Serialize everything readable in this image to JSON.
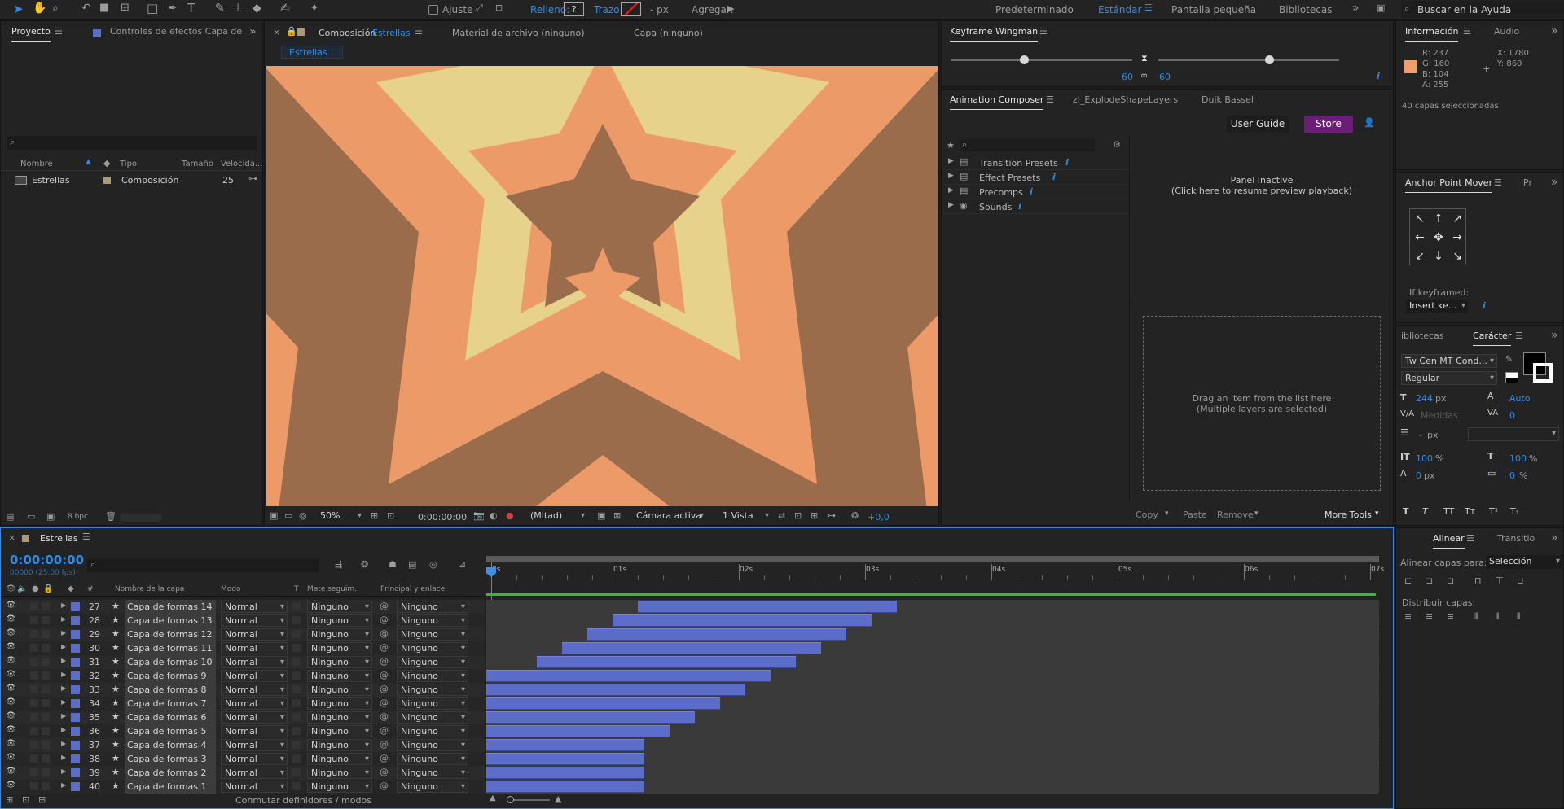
{
  "toolbar": {
    "snap_label": "Ajuste",
    "fill_label": "Relleno:",
    "fill_value": "?",
    "stroke_label": "Trazo:",
    "stroke_unit": "-  px",
    "add_label": "Agregar:",
    "workspaces": [
      "Predeterminado",
      "Estándar",
      "Pantalla pequeña",
      "Bibliotecas"
    ],
    "active_workspace": "Estándar",
    "search_placeholder": "Buscar en la Ayuda"
  },
  "project": {
    "tab": "Proyecto",
    "effects_tab": "Controles de efectos Capa de",
    "cols": [
      "Nombre",
      "Tipo",
      "Tamaño",
      "Velocida..."
    ],
    "item_name": "Estrellas",
    "item_type": "Composición",
    "item_speed": "25",
    "bpc": "8 bpc"
  },
  "comp": {
    "tab_prefix": "Composición",
    "tab_name": "Estrellas",
    "footage_tab": "Material de archivo  (ninguno)",
    "layer_tab": "Capa  (ninguno)",
    "breadcrumb": "Estrellas",
    "zoom": "50%",
    "timecode": "0:00:00:00",
    "resolution": "(Mitad)",
    "camera": "Cámara activa",
    "views": "1 Vista",
    "exposure": "+0,0"
  },
  "colors": {
    "bg_salmon": "#ec9b68",
    "brown": "#9b6c4c",
    "cream": "#e6d28a",
    "accent": "#2d8ceb",
    "layer_bar": "#5c6cc9"
  },
  "wingman": {
    "title": "Keyframe Wingman",
    "left_val": "60",
    "right_val": "60"
  },
  "composer": {
    "tabs": [
      "Animation Composer",
      "zl_ExplodeShapeLayers",
      "Duik Bassel"
    ],
    "guide_btn": "User Guide",
    "store_btn": "Store",
    "tree": [
      "Transition Presets",
      "Effect Presets",
      "Precomps",
      "Sounds"
    ],
    "inactive_1": "Panel Inactive",
    "inactive_2": "(Click here to resume preview playback)",
    "drop_1": "Drag an item from the list here",
    "drop_2": "(Multiple layers are selected)",
    "copy": "Copy",
    "paste": "Paste",
    "remove": "Remove",
    "more": "More Tools"
  },
  "info": {
    "tab": "Información",
    "audio_tab": "Audio",
    "r": "R:  237",
    "g": "G:  160",
    "b": "B:  104",
    "a": "A:  255",
    "x": "X:  1780",
    "y": "Y:  860",
    "selected": "40 capas seleccionadas"
  },
  "apm": {
    "title": "Anchor Point Mover",
    "extra": "Pr",
    "if_label": "If keyframed:",
    "if_value": "Insert ke..."
  },
  "char": {
    "libs": "ibliotecas",
    "tab": "Carácter",
    "font": "Tw Cen MT Cond...",
    "style": "Regular",
    "size": "244",
    "size_unit": "px",
    "leading": "Auto",
    "kern": "Medidas",
    "track": "0",
    "stroke_w": "-",
    "stroke_unit": "px",
    "vscale": "100",
    "hscale": "100",
    "pct": "%",
    "baseline": "0",
    "tsume": "0"
  },
  "align": {
    "tab": "Alinear",
    "trans_tab": "Transitio",
    "align_to_label": "Alinear capas para:",
    "align_to": "Selección",
    "distribute": "Distribuir capas:"
  },
  "timeline": {
    "tab": "Estrellas",
    "timecode": "0:00:00:00",
    "fps": "00000 (25.00 fps)",
    "col_name": "Nombre de la capa",
    "col_mode": "Modo",
    "col_t": "T",
    "col_track": "Mate seguim.",
    "col_parent": "Principal y enlace",
    "ticks": [
      "0s",
      "01s",
      "02s",
      "03s",
      "04s",
      "05s",
      "06s",
      "07s"
    ],
    "toggle_label": "Conmutar definidores / modos",
    "layers": [
      {
        "num": "27",
        "name": "Capa de formas 14",
        "mode": "Normal",
        "track": "Ninguno",
        "parent": "Ninguno",
        "start": 1.2,
        "end": 3.25
      },
      {
        "num": "28",
        "name": "Capa de formas 13",
        "mode": "Normal",
        "track": "Ninguno",
        "parent": "Ninguno",
        "start": 1.0,
        "end": 3.05
      },
      {
        "num": "29",
        "name": "Capa de formas 12",
        "mode": "Normal",
        "track": "Ninguno",
        "parent": "Ninguno",
        "start": 0.8,
        "end": 2.85
      },
      {
        "num": "30",
        "name": "Capa de formas 11",
        "mode": "Normal",
        "track": "Ninguno",
        "parent": "Ninguno",
        "start": 0.6,
        "end": 2.65
      },
      {
        "num": "31",
        "name": "Capa de formas 10",
        "mode": "Normal",
        "track": "Ninguno",
        "parent": "Ninguno",
        "start": 0.4,
        "end": 2.45
      },
      {
        "num": "32",
        "name": "Capa de formas 9",
        "mode": "Normal",
        "track": "Ninguno",
        "parent": "Ninguno",
        "start": 0.0,
        "end": 2.25
      },
      {
        "num": "33",
        "name": "Capa de formas 8",
        "mode": "Normal",
        "track": "Ninguno",
        "parent": "Ninguno",
        "start": 0.0,
        "end": 2.05
      },
      {
        "num": "34",
        "name": "Capa de formas 7",
        "mode": "Normal",
        "track": "Ninguno",
        "parent": "Ninguno",
        "start": 0.0,
        "end": 1.85
      },
      {
        "num": "35",
        "name": "Capa de formas 6",
        "mode": "Normal",
        "track": "Ninguno",
        "parent": "Ninguno",
        "start": 0.0,
        "end": 1.65
      },
      {
        "num": "36",
        "name": "Capa de formas 5",
        "mode": "Normal",
        "track": "Ninguno",
        "parent": "Ninguno",
        "start": 0.0,
        "end": 1.45
      },
      {
        "num": "37",
        "name": "Capa de formas 4",
        "mode": "Normal",
        "track": "Ninguno",
        "parent": "Ninguno",
        "start": 0.0,
        "end": 1.25
      },
      {
        "num": "38",
        "name": "Capa de formas 3",
        "mode": "Normal",
        "track": "Ninguno",
        "parent": "Ninguno",
        "start": 0.0,
        "end": 1.25
      },
      {
        "num": "39",
        "name": "Capa de formas 2",
        "mode": "Normal",
        "track": "Ninguno",
        "parent": "Ninguno",
        "start": 0.0,
        "end": 1.25
      },
      {
        "num": "40",
        "name": "Capa de formas 1",
        "mode": "Normal",
        "track": "Ninguno",
        "parent": "Ninguno",
        "start": 0.0,
        "end": 1.25
      }
    ]
  }
}
